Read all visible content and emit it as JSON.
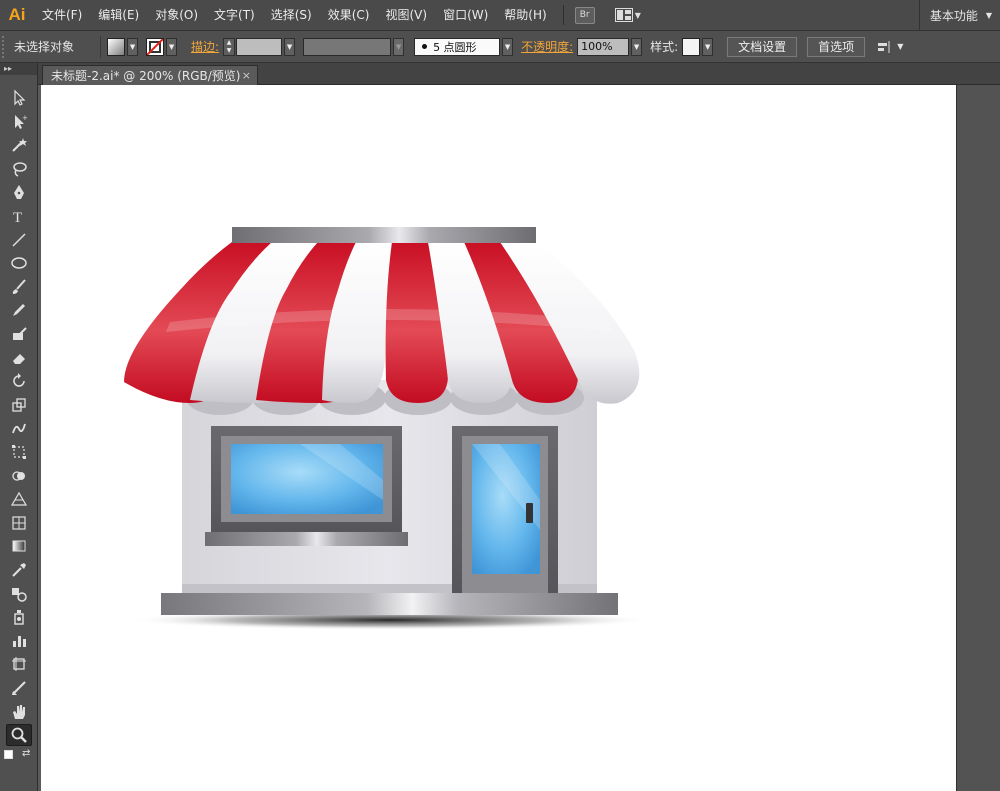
{
  "app": {
    "logo": "Ai"
  },
  "menu": [
    {
      "name": "menu-file",
      "label": "文件(F)"
    },
    {
      "name": "menu-edit",
      "label": "编辑(E)"
    },
    {
      "name": "menu-object",
      "label": "对象(O)"
    },
    {
      "name": "menu-type",
      "label": "文字(T)"
    },
    {
      "name": "menu-select",
      "label": "选择(S)"
    },
    {
      "name": "menu-effect",
      "label": "效果(C)"
    },
    {
      "name": "menu-view",
      "label": "视图(V)"
    },
    {
      "name": "menu-window",
      "label": "窗口(W)"
    },
    {
      "name": "menu-help",
      "label": "帮助(H)"
    }
  ],
  "menubar": {
    "bridge_label": "Br",
    "workspace_label": "基本功能"
  },
  "controlbar": {
    "selection_status": "未选择对象",
    "stroke_label": "描边:",
    "brush_value": "5 点圆形",
    "opacity_label": "不透明度:",
    "opacity_value": "100%",
    "style_label": "样式:",
    "document_setup_label": "文档设置",
    "preferences_label": "首选项"
  },
  "document": {
    "tab_title": "未标题-2.ai* @ 200% (RGB/预览)",
    "close_glyph": "×"
  },
  "tools": [
    "selection-tool-icon",
    "direct-selection-tool-icon",
    "magic-wand-tool-icon",
    "lasso-tool-icon",
    "pen-tool-icon",
    "type-tool-icon",
    "line-segment-tool-icon",
    "ellipse-tool-icon",
    "paintbrush-tool-icon",
    "pencil-tool-icon",
    "blob-brush-tool-icon",
    "eraser-tool-icon",
    "rotate-tool-icon",
    "scale-tool-icon",
    "warp-tool-icon",
    "free-transform-tool-icon",
    "shape-builder-tool-icon",
    "perspective-grid-tool-icon",
    "mesh-tool-icon",
    "gradient-tool-icon",
    "eyedropper-tool-icon",
    "blend-tool-icon",
    "symbol-sprayer-tool-icon",
    "column-graph-tool-icon",
    "artboard-tool-icon",
    "slice-tool-icon",
    "hand-tool-icon",
    "zoom-tool-icon"
  ],
  "colors": {
    "awning_red": "#d9122b",
    "awning_white": "#f4f4f6",
    "glass_blue": "#5fb4ea",
    "frame_gray": "#6a6a6e",
    "wall_gray": "#dcdbe0",
    "accent_orange": "#f2a53a"
  }
}
